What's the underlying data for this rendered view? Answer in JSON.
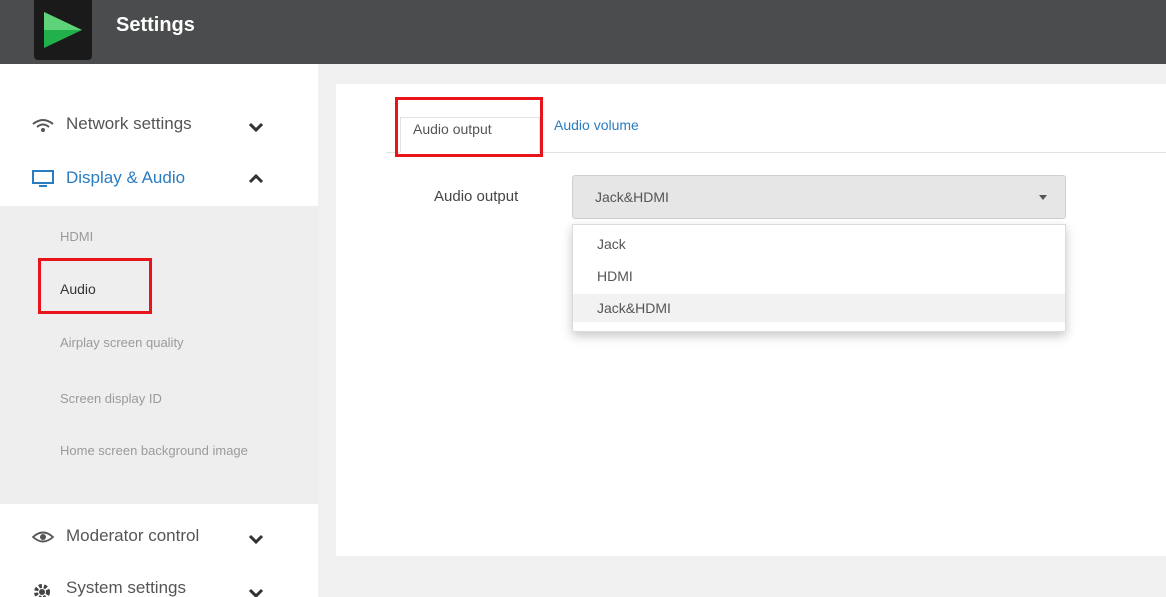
{
  "header": {
    "title": "Settings",
    "logo_icon": "green-play-logo"
  },
  "sidebar": {
    "sections": [
      {
        "label": "Network settings",
        "icon": "wifi-icon",
        "chevron": "chevron-down"
      },
      {
        "label": "Display & Audio",
        "icon": "monitor-icon",
        "chevron": "chevron-up",
        "color": "#2a7cc0"
      },
      {
        "label": "Moderator control",
        "icon": "eye-icon",
        "chevron": "chevron-down"
      },
      {
        "label": "System settings",
        "icon": "gear-icon",
        "chevron": "chevron-down"
      }
    ],
    "submenu": [
      "HDMI",
      "Audio",
      "Airplay screen quality",
      "Screen display ID",
      "Home screen background image"
    ]
  },
  "tabs": [
    {
      "label": "Audio output",
      "active": true
    },
    {
      "label": "Audio volume",
      "active": false
    }
  ],
  "form": {
    "label": "Audio output",
    "selected": "Jack&HDMI",
    "options": [
      "Jack",
      "HDMI",
      "Jack&HDMI"
    ]
  },
  "colors": {
    "accent": "#2a7cc0",
    "highlight": "#e8141c",
    "topbar": "#4a4c4d",
    "logo_green": "#22b04b"
  }
}
